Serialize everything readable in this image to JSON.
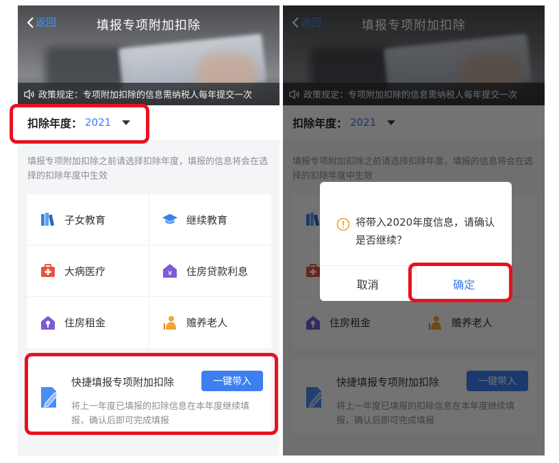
{
  "colors": {
    "accent": "#3b7ded",
    "highlight": "#e8111c",
    "overlay": "rgba(0,0,0,0.55)"
  },
  "screen": {
    "back_label": "返回",
    "title": "填报专项附加扣除",
    "notice": "政策规定：专项附加扣除的信息需纳税人每年提交一次",
    "year_label": "扣除年度：",
    "year_value": "2021",
    "hint": "填报专项附加扣除之前请选择扣除年度，填报的信息将会在选择的扣除年度中生效",
    "categories": [
      {
        "label": "子女教育",
        "icon": "books-icon"
      },
      {
        "label": "继续教育",
        "icon": "graduation-cap-icon"
      },
      {
        "label": "大病医疗",
        "icon": "medical-kit-icon"
      },
      {
        "label": "住房贷款利息",
        "icon": "house-loan-icon"
      },
      {
        "label": "住房租金",
        "icon": "house-key-icon"
      },
      {
        "label": "赡养老人",
        "icon": "elderly-person-icon"
      }
    ],
    "quick": {
      "title": "快捷填报专项附加扣除",
      "button": "一键带入",
      "desc": "将上一年度已填报的扣除信息在本年度继续填报，确认后即可完成填报"
    }
  },
  "dialog": {
    "message": "将带入2020年度信息，请确认是否继续？",
    "cancel": "取消",
    "confirm": "确定"
  }
}
